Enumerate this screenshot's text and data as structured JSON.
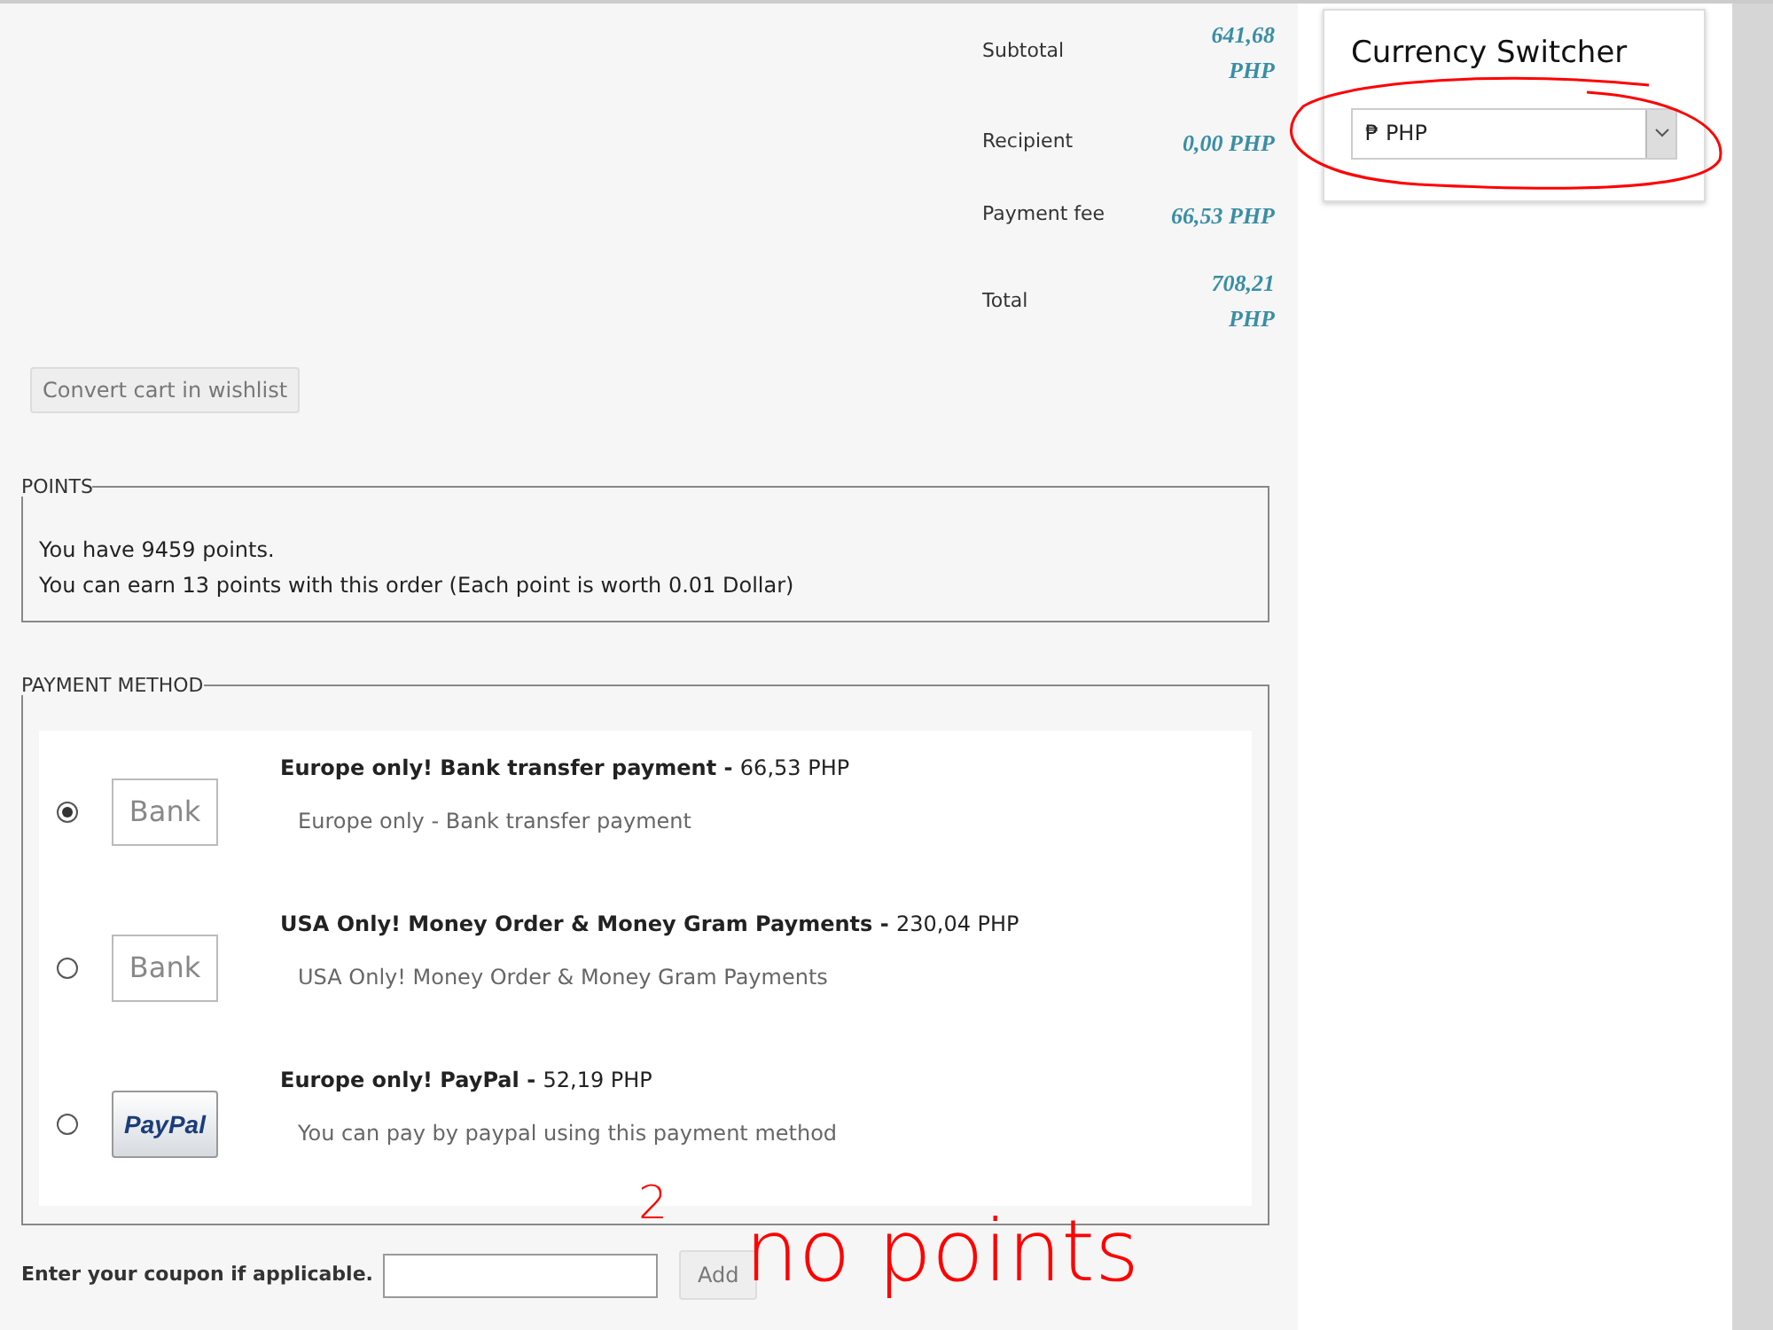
{
  "totals": [
    {
      "label": "Subtotal",
      "value": "641,68 PHP"
    },
    {
      "label": "Recipient",
      "value": "0,00 PHP"
    },
    {
      "label": "Payment fee",
      "value": "66,53 PHP"
    },
    {
      "label": "Total",
      "value": "708,21 PHP"
    }
  ],
  "wishlist_button": "Convert cart in wishlist",
  "points": {
    "legend": "POINTS",
    "lines": [
      "You have 9459 points.",
      "You can earn 13 points with this order (Each point is worth 0.01 Dollar)"
    ]
  },
  "payment": {
    "legend": "PAYMENT METHOD",
    "methods": [
      {
        "selected": true,
        "kind": "bank",
        "logo": "Bank",
        "title": "Europe only! Bank transfer payment -",
        "price": "66,53 PHP",
        "description": "Europe only - Bank transfer payment"
      },
      {
        "selected": false,
        "kind": "bank",
        "logo": "Bank",
        "title": "USA Only! Money Order & Money Gram Payments -",
        "price": "230,04 PHP",
        "description": "USA Only! Money Order & Money Gram Payments"
      },
      {
        "selected": false,
        "kind": "paypal",
        "logo": "PayPal",
        "title": "Europe only! PayPal -",
        "price": "52,19 PHP",
        "description": "You can pay by paypal using this payment method"
      }
    ]
  },
  "coupon": {
    "label": "Enter your coupon if applicable.",
    "button": "Add"
  },
  "currency_switcher": {
    "title": "Currency Switcher",
    "value": "₱ PHP"
  },
  "annotations": [
    {
      "text": "2"
    },
    {
      "text": "no points"
    }
  ]
}
